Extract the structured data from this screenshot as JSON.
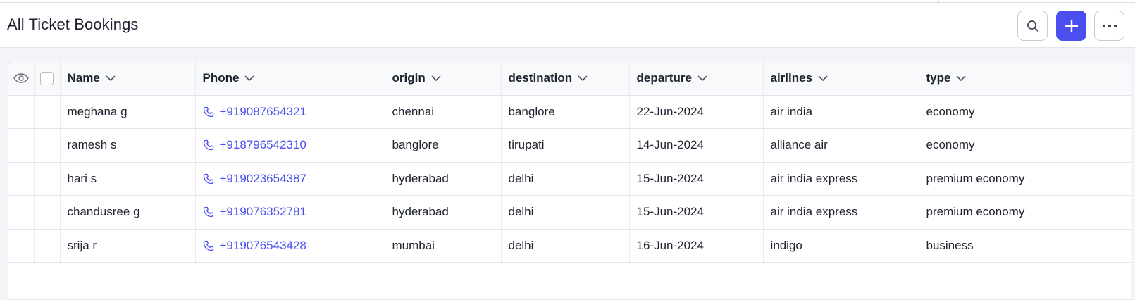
{
  "page": {
    "title": "All Ticket Bookings"
  },
  "header_actions": [
    {
      "name": "search-button",
      "icon": "search-icon"
    },
    {
      "name": "add-button",
      "icon": "plus-icon"
    },
    {
      "name": "more-button",
      "icon": "more-horizontal-icon"
    }
  ],
  "colors": {
    "accent": "#4b4ff0",
    "background": "#f3f4f7"
  },
  "table": {
    "columns": [
      "Name",
      "Phone",
      "origin",
      "destination",
      "departure",
      "airlines",
      "type"
    ],
    "rows": [
      [
        "meghana g",
        "+919087654321",
        "chennai",
        "banglore",
        "22-Jun-2024",
        "air india",
        "economy"
      ],
      [
        "ramesh s",
        "+918796542310",
        "banglore",
        "tirupati",
        "14-Jun-2024",
        "alliance air",
        "economy"
      ],
      [
        "hari s",
        "+919023654387",
        "hyderabad",
        "delhi",
        "15-Jun-2024",
        "air india express",
        "premium economy"
      ],
      [
        "chandusree g",
        "+919076352781",
        "hyderabad",
        "delhi",
        "15-Jun-2024",
        "air india express",
        "premium economy"
      ],
      [
        "srija r",
        "+919076543428",
        "mumbai",
        "delhi",
        "16-Jun-2024",
        "indigo",
        "business"
      ]
    ]
  }
}
